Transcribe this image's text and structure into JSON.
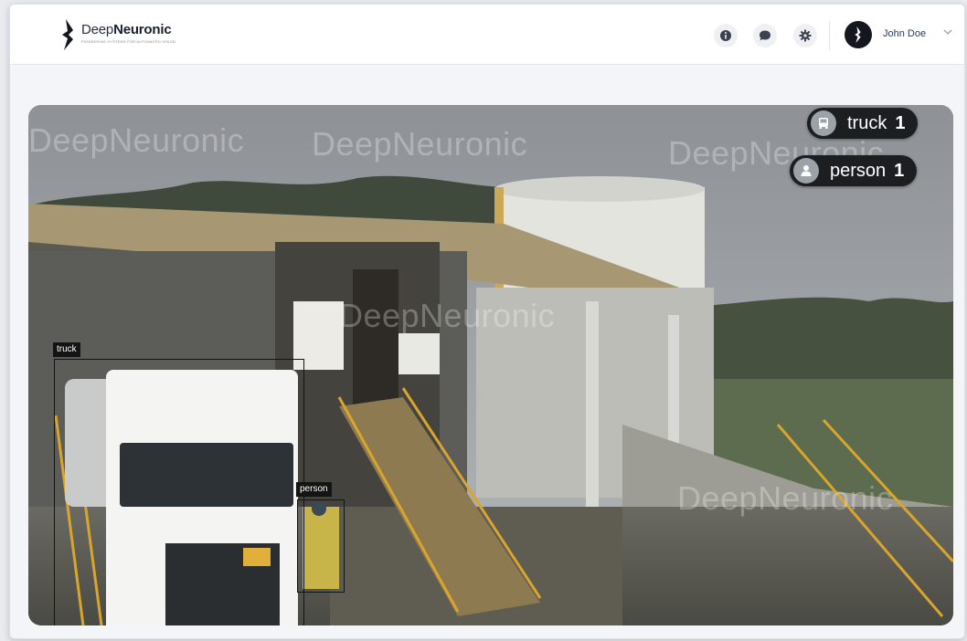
{
  "header": {
    "brand_part1": "Deep",
    "brand_part2": "Neuronic",
    "tagline": "PIONEERING SYSTEMS FOR AUTOMATED VISION",
    "icons": [
      "info-icon",
      "chat-icon",
      "gear-icon"
    ],
    "user_name": "John Doe"
  },
  "video": {
    "watermark": "DeepNeuronic",
    "counters": [
      {
        "label": "truck",
        "count": "1",
        "icon": "truck-icon"
      },
      {
        "label": "person",
        "count": "1",
        "icon": "person-icon"
      }
    ],
    "detections": [
      {
        "label": "truck"
      },
      {
        "label": "person"
      }
    ]
  },
  "colors": {
    "header_bg": "#ffffff",
    "page_bg": "#f4f5f8",
    "pill_bg": "#1c1f22",
    "detection_box": "#141414",
    "user_name": "#2a3a5c"
  }
}
